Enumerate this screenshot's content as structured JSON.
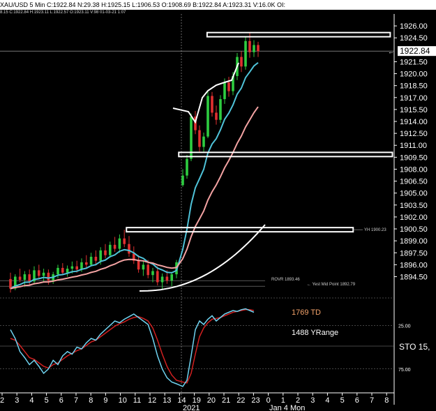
{
  "header": {
    "title": "XAU/USD 5 Min  C:1922.84  N:29.38  H:1925.15  L:1906.53  O:1908.69  B:1922.84  A:1923.31  V:16.0K  OI:",
    "sub": "8.15  C:1922.84  H:1923.11  L:1922.57  O:1923.11  V:98  01-03-21  1:07"
  },
  "colors": {
    "bg": "#000000",
    "candle_up": "#2ecc40",
    "candle_down": "#e03030",
    "ma_fast": "#4fc3d9",
    "ma_slow": "#f4a3a3",
    "white_line": "#ffffff",
    "stoch_k": "#6fd3f0",
    "stoch_d": "#d02020"
  },
  "chart_data": [
    {
      "type": "line",
      "name": "price",
      "y_ticks": [
        "1926.00",
        "1924.50",
        "1922.84",
        "1921.50",
        "1920.00",
        "1918.50",
        "1917.00",
        "1915.50",
        "1914.00",
        "1912.50",
        "1911.00",
        "1909.50",
        "1908.00",
        "1906.50",
        "1905.00",
        "1903.50",
        "1902.00",
        "1900.50",
        "1899.00",
        "1897.50",
        "1896.00",
        "1894.50"
      ],
      "current_price": "1922.84",
      "ylim": [
        1892.0,
        1927.5
      ],
      "x_ticks": [
        "2",
        "3",
        "4",
        "5",
        "6",
        "7",
        "8",
        "9",
        "10",
        "11",
        "12",
        "13",
        "14",
        "19",
        "20",
        "21",
        "22",
        "23",
        "0",
        "1",
        "2",
        "3",
        "4",
        "5",
        "6",
        "7",
        "8"
      ],
      "x_sub_labels": [
        "2021",
        "Jan 4 Mon"
      ],
      "levels": [
        {
          "price": 1924.9,
          "from": 0.475,
          "to": 0.895
        },
        {
          "price": 1909.85,
          "from": 0.41,
          "to": 0.9
        },
        {
          "price": 1900.4,
          "from": 0.29,
          "to": 0.81
        }
      ],
      "labels": {
        "yh": "YH 1900.23",
        "rovr": "ROVR 1893.46",
        "yest_mid": "← Yest Mid Point 1892.79"
      },
      "candles": [
        [
          1894.2,
          1895.0,
          1892.5,
          1893.0
        ],
        [
          1893.0,
          1894.8,
          1892.8,
          1894.5
        ],
        [
          1894.5,
          1895.5,
          1893.8,
          1894.1
        ],
        [
          1894.1,
          1895.2,
          1893.2,
          1894.8
        ],
        [
          1894.8,
          1895.4,
          1893.5,
          1893.9
        ],
        [
          1893.9,
          1895.8,
          1893.5,
          1895.3
        ],
        [
          1895.3,
          1896.0,
          1894.2,
          1894.6
        ],
        [
          1894.6,
          1895.5,
          1893.8,
          1895.0
        ],
        [
          1895.0,
          1895.4,
          1893.5,
          1894.0
        ],
        [
          1894.0,
          1895.1,
          1893.6,
          1894.8
        ],
        [
          1894.8,
          1896.0,
          1894.3,
          1895.6
        ],
        [
          1895.6,
          1896.2,
          1894.8,
          1895.0
        ],
        [
          1895.0,
          1895.9,
          1894.5,
          1895.5
        ],
        [
          1895.5,
          1896.4,
          1894.9,
          1895.8
        ],
        [
          1895.8,
          1896.5,
          1895.0,
          1895.4
        ],
        [
          1895.4,
          1896.8,
          1895.1,
          1896.3
        ],
        [
          1896.3,
          1897.2,
          1895.6,
          1896.0
        ],
        [
          1896.0,
          1897.5,
          1895.8,
          1897.0
        ],
        [
          1897.0,
          1897.8,
          1895.9,
          1896.5
        ],
        [
          1896.5,
          1898.2,
          1896.0,
          1897.8
        ],
        [
          1897.8,
          1898.6,
          1896.8,
          1897.2
        ],
        [
          1897.2,
          1898.9,
          1896.9,
          1898.5
        ],
        [
          1898.5,
          1899.5,
          1897.6,
          1898.0
        ],
        [
          1898.0,
          1899.8,
          1897.5,
          1899.3
        ],
        [
          1899.3,
          1900.4,
          1898.2,
          1898.6
        ],
        [
          1898.6,
          1899.6,
          1897.0,
          1897.4
        ],
        [
          1897.4,
          1898.3,
          1896.1,
          1896.5
        ],
        [
          1896.5,
          1897.2,
          1895.0,
          1895.4
        ],
        [
          1895.4,
          1896.4,
          1894.6,
          1896.0
        ],
        [
          1896.0,
          1896.6,
          1894.3,
          1894.7
        ],
        [
          1894.7,
          1895.6,
          1893.8,
          1895.2
        ],
        [
          1895.2,
          1895.8,
          1893.4,
          1893.8
        ],
        [
          1893.8,
          1894.9,
          1892.9,
          1894.5
        ],
        [
          1894.5,
          1895.3,
          1893.6,
          1894.0
        ],
        [
          1894.0,
          1895.1,
          1893.3,
          1894.8
        ],
        [
          1894.8,
          1896.6,
          1894.3,
          1896.3
        ],
        [
          1906.0,
          1908.0,
          1905.8,
          1907.2
        ],
        [
          1907.2,
          1909.8,
          1906.8,
          1909.3
        ],
        [
          1909.3,
          1915.0,
          1909.0,
          1914.6
        ],
        [
          1914.6,
          1915.3,
          1912.4,
          1912.9
        ],
        [
          1912.9,
          1913.5,
          1910.2,
          1910.8
        ],
        [
          1910.8,
          1912.6,
          1910.2,
          1912.1
        ],
        [
          1912.1,
          1917.8,
          1911.9,
          1917.2
        ],
        [
          1917.2,
          1917.7,
          1914.6,
          1915.1
        ],
        [
          1915.1,
          1916.0,
          1913.6,
          1914.2
        ],
        [
          1914.2,
          1917.3,
          1913.8,
          1916.8
        ],
        [
          1916.8,
          1919.4,
          1916.2,
          1918.9
        ],
        [
          1918.9,
          1919.6,
          1917.1,
          1917.8
        ],
        [
          1917.8,
          1920.2,
          1917.3,
          1919.7
        ],
        [
          1919.7,
          1922.6,
          1919.2,
          1922.1
        ],
        [
          1922.1,
          1922.8,
          1920.2,
          1920.9
        ],
        [
          1920.9,
          1924.6,
          1920.5,
          1924.1
        ],
        [
          1924.1,
          1925.15,
          1922.0,
          1922.7
        ],
        [
          1922.7,
          1924.2,
          1922.1,
          1923.6
        ],
        [
          1923.6,
          1924.0,
          1922.1,
          1922.84
        ]
      ]
    },
    {
      "type": "line",
      "name": "STO",
      "y_ticks": [
        "25.00",
        "75.00"
      ],
      "labels": {
        "td": "1769 TD",
        "yrange": "1488 YRange",
        "sto": "STO  15,"
      },
      "k": [
        70,
        60,
        45,
        38,
        30,
        35,
        28,
        20,
        25,
        35,
        30,
        40,
        45,
        42,
        50,
        48,
        55,
        60,
        58,
        65,
        70,
        75,
        80,
        78,
        82,
        85,
        88,
        84,
        80,
        76,
        60,
        40,
        25,
        15,
        10,
        8,
        5,
        12,
        40,
        70,
        80,
        76,
        82,
        86,
        80,
        84,
        88,
        90,
        92,
        91,
        93,
        94,
        92,
        90
      ],
      "d": [
        60,
        58,
        52,
        45,
        38,
        36,
        32,
        28,
        26,
        30,
        32,
        36,
        40,
        43,
        46,
        48,
        52,
        56,
        58,
        62,
        66,
        70,
        74,
        77,
        79,
        82,
        84,
        85,
        83,
        80,
        72,
        58,
        42,
        28,
        18,
        12,
        10,
        9,
        20,
        42,
        62,
        72,
        78,
        82,
        83,
        84,
        86,
        88,
        90,
        91,
        92,
        93,
        93,
        92
      ]
    }
  ]
}
